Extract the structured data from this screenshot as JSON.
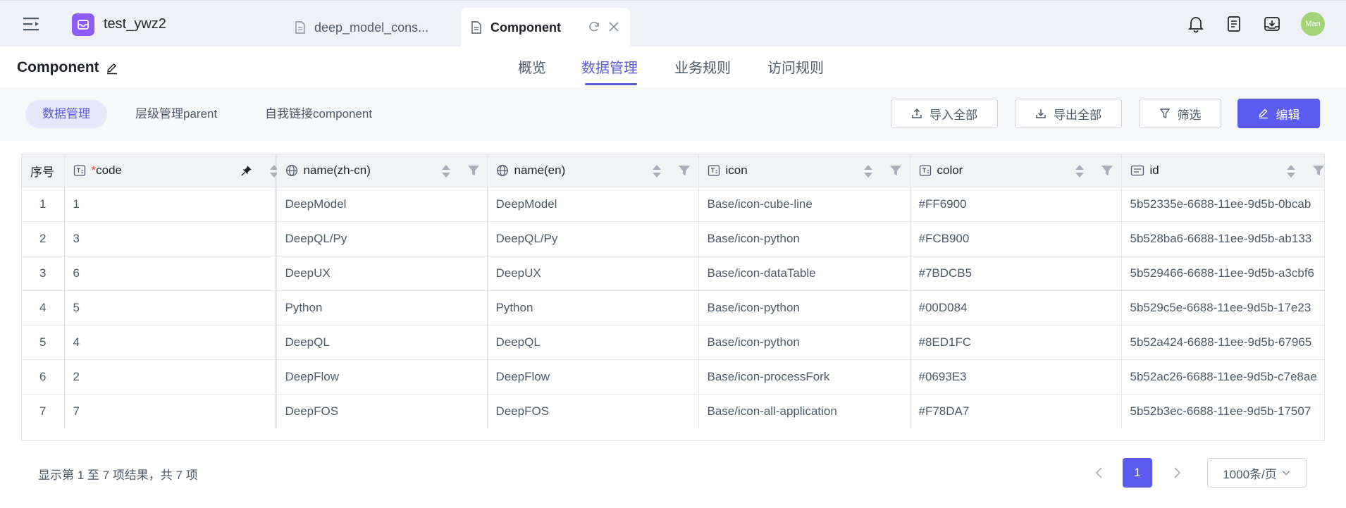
{
  "topbar": {
    "app_name": "test_ywz2",
    "tabs": [
      {
        "label": "deep_model_cons..."
      },
      {
        "label": "Component"
      }
    ],
    "avatar_text": "Man"
  },
  "header": {
    "title": "Component",
    "tabs": [
      {
        "label": "概览"
      },
      {
        "label": "数据管理"
      },
      {
        "label": "业务规则"
      },
      {
        "label": "访问规则"
      }
    ],
    "accent_color": "#5b5bf0"
  },
  "subbar": {
    "tabs": [
      {
        "label": "数据管理"
      },
      {
        "label": "层级管理parent"
      },
      {
        "label": "自我链接component"
      }
    ],
    "buttons": {
      "import": "导入全部",
      "export": "导出全部",
      "filter": "筛选",
      "edit": "编辑"
    }
  },
  "table": {
    "columns": [
      {
        "label": "序号"
      },
      {
        "label": "*code",
        "required": true,
        "text": "code"
      },
      {
        "label": "name(zh-cn)"
      },
      {
        "label": "name(en)"
      },
      {
        "label": "icon"
      },
      {
        "label": "color"
      },
      {
        "label": "id"
      }
    ],
    "rows": [
      [
        "1",
        "1",
        "DeepModel",
        "DeepModel",
        "Base/icon-cube-line",
        "#FF6900",
        "5b52335e-6688-11ee-9d5b-0bcab"
      ],
      [
        "2",
        "3",
        "DeepQL/Py",
        "DeepQL/Py",
        "Base/icon-python",
        "#FCB900",
        "5b528ba6-6688-11ee-9d5b-ab133"
      ],
      [
        "3",
        "6",
        "DeepUX",
        "DeepUX",
        "Base/icon-dataTable",
        "#7BDCB5",
        "5b529466-6688-11ee-9d5b-a3cbf6"
      ],
      [
        "4",
        "5",
        "Python",
        "Python",
        "Base/icon-python",
        "#00D084",
        "5b529c5e-6688-11ee-9d5b-17e23"
      ],
      [
        "5",
        "4",
        "DeepQL",
        "DeepQL",
        "Base/icon-python",
        "#8ED1FC",
        "5b52a424-6688-11ee-9d5b-67965"
      ],
      [
        "6",
        "2",
        "DeepFlow",
        "DeepFlow",
        "Base/icon-processFork",
        "#0693E3",
        "5b52ac26-6688-11ee-9d5b-c7e8ae"
      ],
      [
        "7",
        "7",
        "DeepFOS",
        "DeepFOS",
        "Base/icon-all-application",
        "#F78DA7",
        "5b52b3ec-6688-11ee-9d5b-17507"
      ]
    ]
  },
  "footer": {
    "summary": "显示第 1 至 7 项结果，共 7 项",
    "current_page": "1",
    "page_size": "1000条/页"
  }
}
